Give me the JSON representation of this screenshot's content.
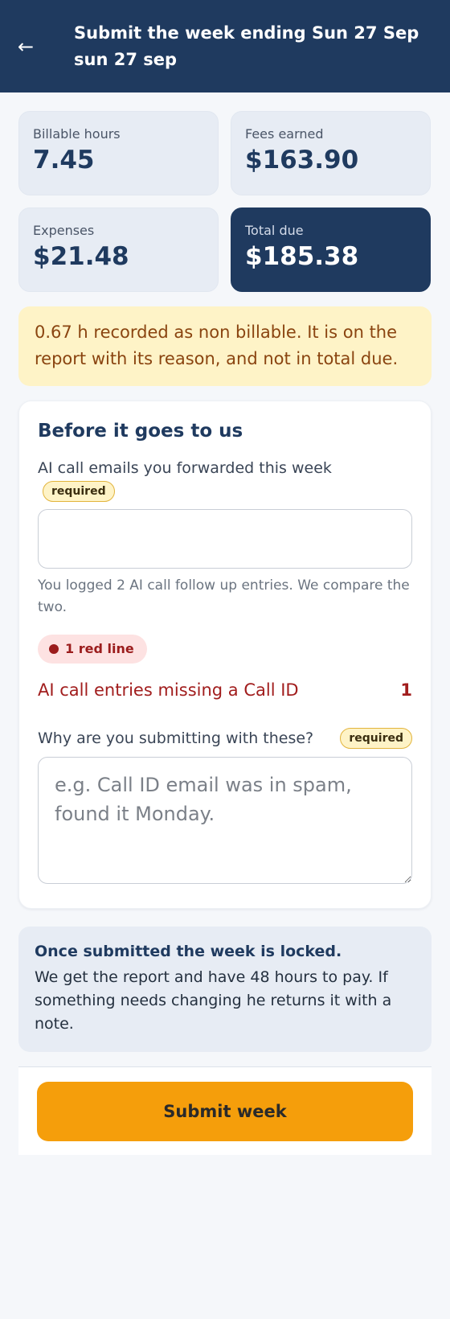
{
  "header": {
    "back_label": "←",
    "title_line1": "Submit the week ending Sun 27 Sep",
    "title_line2": "sun 27 sep"
  },
  "stats": [
    {
      "label": "Billable hours",
      "value": "7.45"
    },
    {
      "label": "Fees earned",
      "value": "$163.90"
    },
    {
      "label": "Expenses",
      "value": "$21.48"
    },
    {
      "label": "Total due",
      "value": "$185.38"
    }
  ],
  "notice": {
    "text": "0.67 h recorded as non billable. It is on the report with its reason, and not in total due."
  },
  "form": {
    "title": "Before it goes to us",
    "emails_label": "AI call emails you forwarded this week",
    "required_badge": "required",
    "emails_value": "",
    "emails_placeholder": "",
    "helper": "You logged 2 AI call follow up entries. We compare the two.",
    "red_line_pill": "1 red line",
    "issue_label": "AI call entries missing a Call ID",
    "issue_count": "1",
    "why_label": "Why are you submitting with these?",
    "why_placeholder": "e.g. Call ID email was in spam, found it Monday."
  },
  "info": {
    "title": "Once submitted the week is locked.",
    "body": "We get the report and have 48 hours to pay. If something needs changing he returns it with a note."
  },
  "footer": {
    "submit_label": "Submit week"
  },
  "colors": {
    "header_bg": "#1f3a5f",
    "accent": "#f59e0b",
    "danger": "#9b1c1c",
    "warning_bg": "#fef3c7"
  },
  "icons": {
    "back": "arrow-left-icon",
    "red_dot": "dot-icon"
  }
}
